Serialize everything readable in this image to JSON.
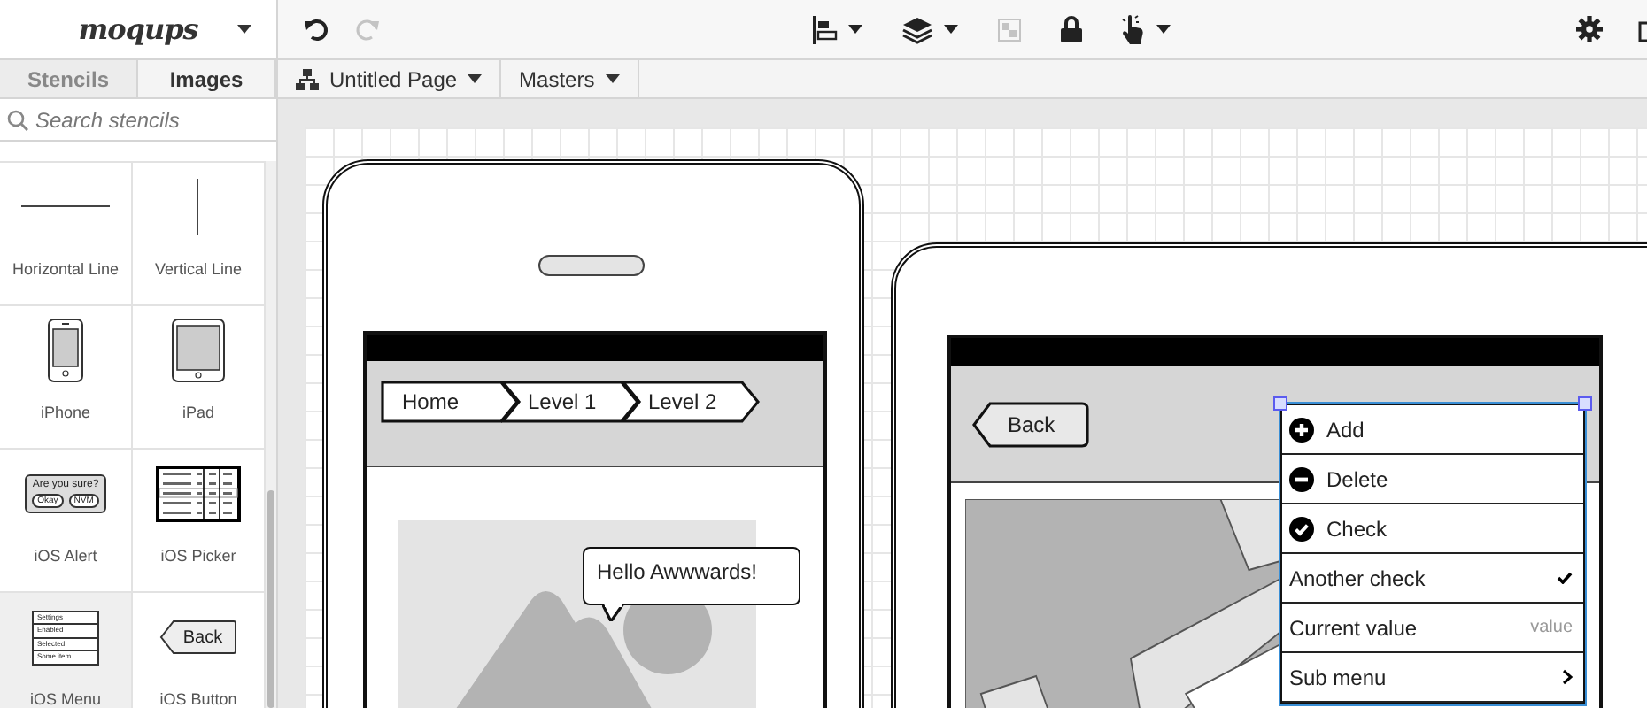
{
  "app": {
    "logo": "moqups"
  },
  "toolbar": [
    {
      "kind": "undo",
      "disabled": false,
      "dropdown": false
    },
    {
      "kind": "redo",
      "disabled": true,
      "dropdown": false
    },
    {
      "kind": "align",
      "disabled": false,
      "dropdown": true
    },
    {
      "kind": "layers",
      "disabled": false,
      "dropdown": true
    },
    {
      "kind": "group",
      "disabled": true,
      "dropdown": false
    },
    {
      "kind": "lock",
      "disabled": false,
      "dropdown": false
    },
    {
      "kind": "interact",
      "disabled": false,
      "dropdown": true
    },
    {
      "kind": "settings",
      "disabled": false,
      "dropdown": false
    },
    {
      "kind": "export",
      "disabled": false,
      "dropdown": false
    }
  ],
  "panel_tabs": [
    {
      "label": "Stencils",
      "selected": false
    },
    {
      "label": "Images",
      "selected": true
    }
  ],
  "page_tabs": [
    {
      "label": "Untitled Page",
      "kind": "page"
    },
    {
      "label": "Masters",
      "kind": "masters"
    }
  ],
  "search": {
    "placeholder": "Search stencils"
  },
  "stencils": [
    {
      "label": "Horizontal Line",
      "kind": "hline",
      "selected": false
    },
    {
      "label": "Vertical Line",
      "kind": "vline",
      "selected": false
    },
    {
      "label": "iPhone",
      "kind": "iphone",
      "selected": false
    },
    {
      "label": "iPad",
      "kind": "ipad",
      "selected": false
    },
    {
      "label": "iOS Alert",
      "kind": "alert",
      "selected": false,
      "texts": [
        "Are you sure?",
        "Okay",
        "NVM"
      ]
    },
    {
      "label": "iOS Picker",
      "kind": "picker",
      "selected": false
    },
    {
      "label": "iOS Menu",
      "kind": "menu",
      "selected": true,
      "texts": [
        "Settings",
        "Enabled",
        "Selected",
        "Some item"
      ]
    },
    {
      "label": "iOS Button",
      "kind": "button",
      "selected": false,
      "texts": [
        "Back"
      ]
    }
  ],
  "canvas": {
    "phone": {
      "breadcrumb": [
        {
          "label": "Home"
        },
        {
          "label": "Level 1"
        },
        {
          "label": "Level 2"
        }
      ],
      "callout": {
        "text": "Hello Awwwards!"
      }
    },
    "tablet": {
      "back_button": {
        "label": "Back"
      },
      "menu": {
        "selected": true,
        "items": [
          {
            "kind": "add",
            "label": "Add"
          },
          {
            "kind": "delete",
            "label": "Delete"
          },
          {
            "kind": "check",
            "label": "Check"
          },
          {
            "kind": "checkmark",
            "label": "Another check",
            "checked": true
          },
          {
            "kind": "value",
            "label": "Current value",
            "value": "value"
          },
          {
            "kind": "submenu",
            "label": "Sub menu"
          }
        ]
      }
    }
  }
}
